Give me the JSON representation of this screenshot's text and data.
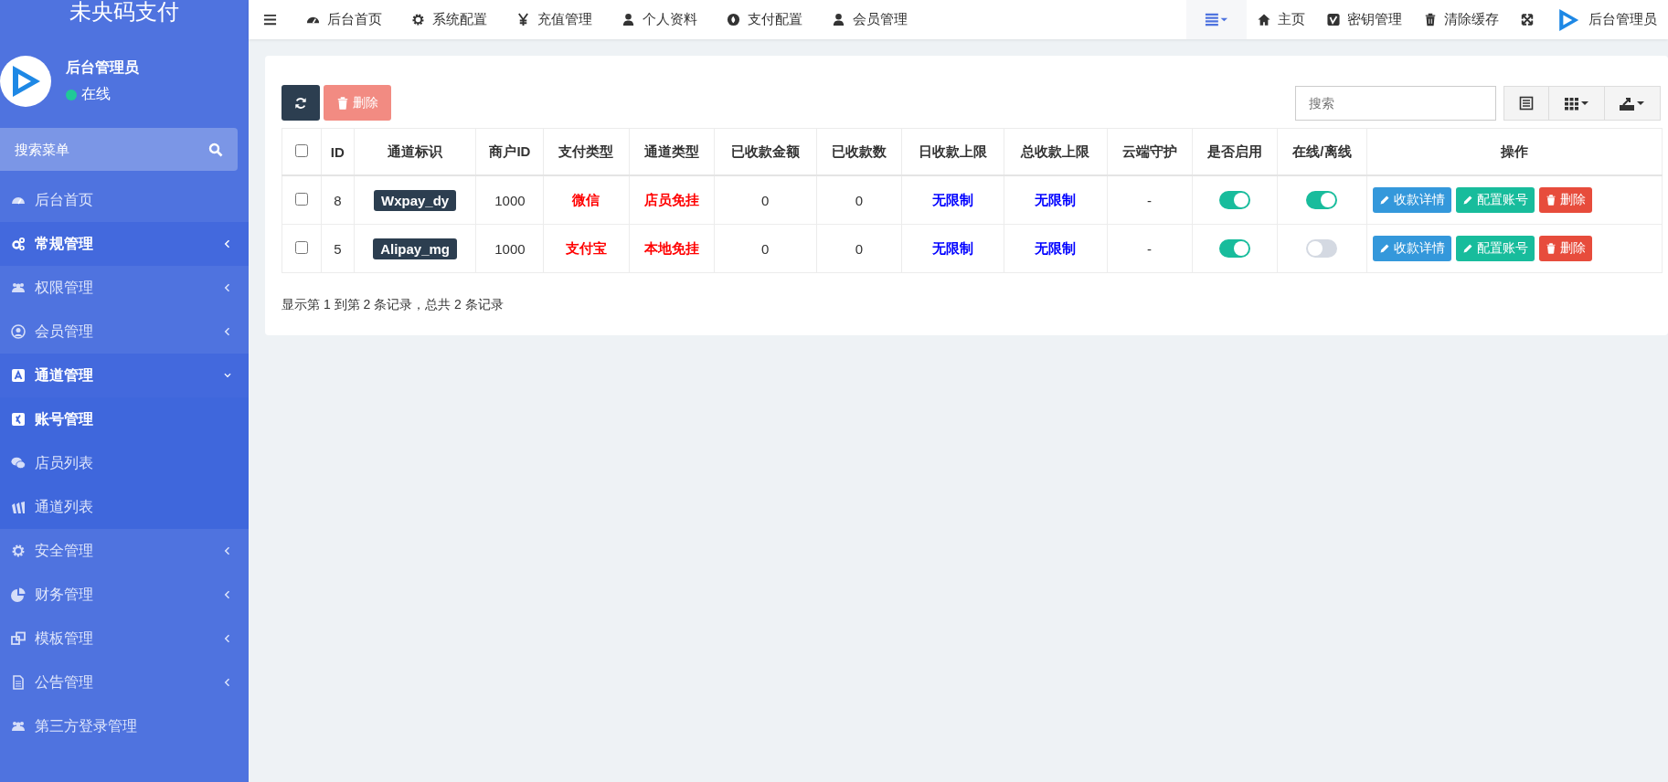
{
  "sidebar": {
    "brand": "未央码支付",
    "user": {
      "name": "后台管理员",
      "status": "在线",
      "online": true
    },
    "search": {
      "placeholder": "搜索菜单"
    },
    "menu": [
      {
        "label": "后台首页",
        "selected": false
      },
      {
        "label": "常规管理",
        "selected": true,
        "expanded": false
      },
      {
        "label": "权限管理",
        "selected": false,
        "expanded": false
      },
      {
        "label": "会员管理",
        "selected": false,
        "expanded": false
      },
      {
        "label": "通道管理",
        "selected": true,
        "expanded": true,
        "children": [
          {
            "label": "账号管理",
            "selected": true
          },
          {
            "label": "店员列表",
            "selected": false
          },
          {
            "label": "通道列表",
            "selected": false
          }
        ]
      },
      {
        "label": "安全管理",
        "selected": false,
        "expanded": false
      },
      {
        "label": "财务管理",
        "selected": false,
        "expanded": false
      },
      {
        "label": "模板管理",
        "selected": false,
        "expanded": false
      },
      {
        "label": "公告管理",
        "selected": false,
        "expanded": false
      },
      {
        "label": "第三方登录管理",
        "selected": false
      }
    ]
  },
  "topbar": {
    "nav": [
      "后台首页",
      "系统配置",
      "充值管理",
      "个人资料",
      "支付配置",
      "会员管理"
    ],
    "right": [
      {
        "kind": "menu",
        "selected": true
      },
      {
        "kind": "link",
        "label": "主页"
      },
      {
        "kind": "link",
        "label": "密钥管理"
      },
      {
        "kind": "link",
        "label": "清除缓存"
      },
      {
        "kind": "fullscreen"
      },
      {
        "kind": "user",
        "label": "后台管理员"
      }
    ]
  },
  "toolbar": {
    "delete_label": "删除",
    "delete_disabled": true,
    "search": {
      "placeholder": "搜索"
    }
  },
  "table": {
    "header_checked": false,
    "columns": [
      "ID",
      "通道标识",
      "商户ID",
      "支付类型",
      "通道类型",
      "已收款金额",
      "已收款数",
      "日收款上限",
      "总收款上限",
      "云端守护",
      "是否启用",
      "在线/离线",
      "操作"
    ],
    "rows": [
      {
        "checked": false,
        "id": "8",
        "tag": "Wxpay_dy",
        "merchant_id": "1000",
        "pay_type": "微信",
        "channel_type": "店员免挂",
        "amount": "0",
        "count": "0",
        "daily_limit": "无限制",
        "total_limit": "无限制",
        "cloud_guard": "-",
        "enabled": true,
        "online": true,
        "actions": [
          {
            "kind": "info",
            "label": "收款详情"
          },
          {
            "kind": "success",
            "label": "配置账号"
          },
          {
            "kind": "danger",
            "label": "删除"
          }
        ]
      },
      {
        "checked": false,
        "id": "5",
        "tag": "Alipay_mg",
        "merchant_id": "1000",
        "pay_type": "支付宝",
        "channel_type": "本地免挂",
        "amount": "0",
        "count": "0",
        "daily_limit": "无限制",
        "total_limit": "无限制",
        "cloud_guard": "-",
        "enabled": true,
        "online": false,
        "actions": [
          {
            "kind": "info",
            "label": "收款详情"
          },
          {
            "kind": "success",
            "label": "配置账号"
          },
          {
            "kind": "danger",
            "label": "删除"
          }
        ]
      }
    ],
    "footer": "显示第 1 到第 2 条记录，总共 2 条记录"
  }
}
